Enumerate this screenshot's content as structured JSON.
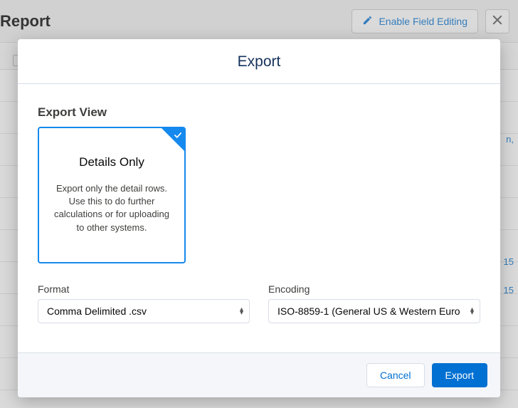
{
  "background": {
    "page_title": "Report",
    "enable_field_editing_label": "Enable Field Editing",
    "right_fragments": [
      "n,",
      "15",
      "15"
    ]
  },
  "modal": {
    "title": "Export",
    "section_label": "Export View",
    "option": {
      "title": "Details Only",
      "description": "Export only the detail rows. Use this to do further calculations or for uploading to other systems."
    },
    "format": {
      "label": "Format",
      "value": "Comma Delimited .csv"
    },
    "encoding": {
      "label": "Encoding",
      "value": "ISO-8859-1 (General US & Western Euro"
    },
    "buttons": {
      "cancel": "Cancel",
      "export": "Export"
    }
  },
  "icons": {
    "pencil": "pencil-icon",
    "close": "close-icon",
    "check": "check-icon",
    "stepper": "stepper-icon"
  }
}
